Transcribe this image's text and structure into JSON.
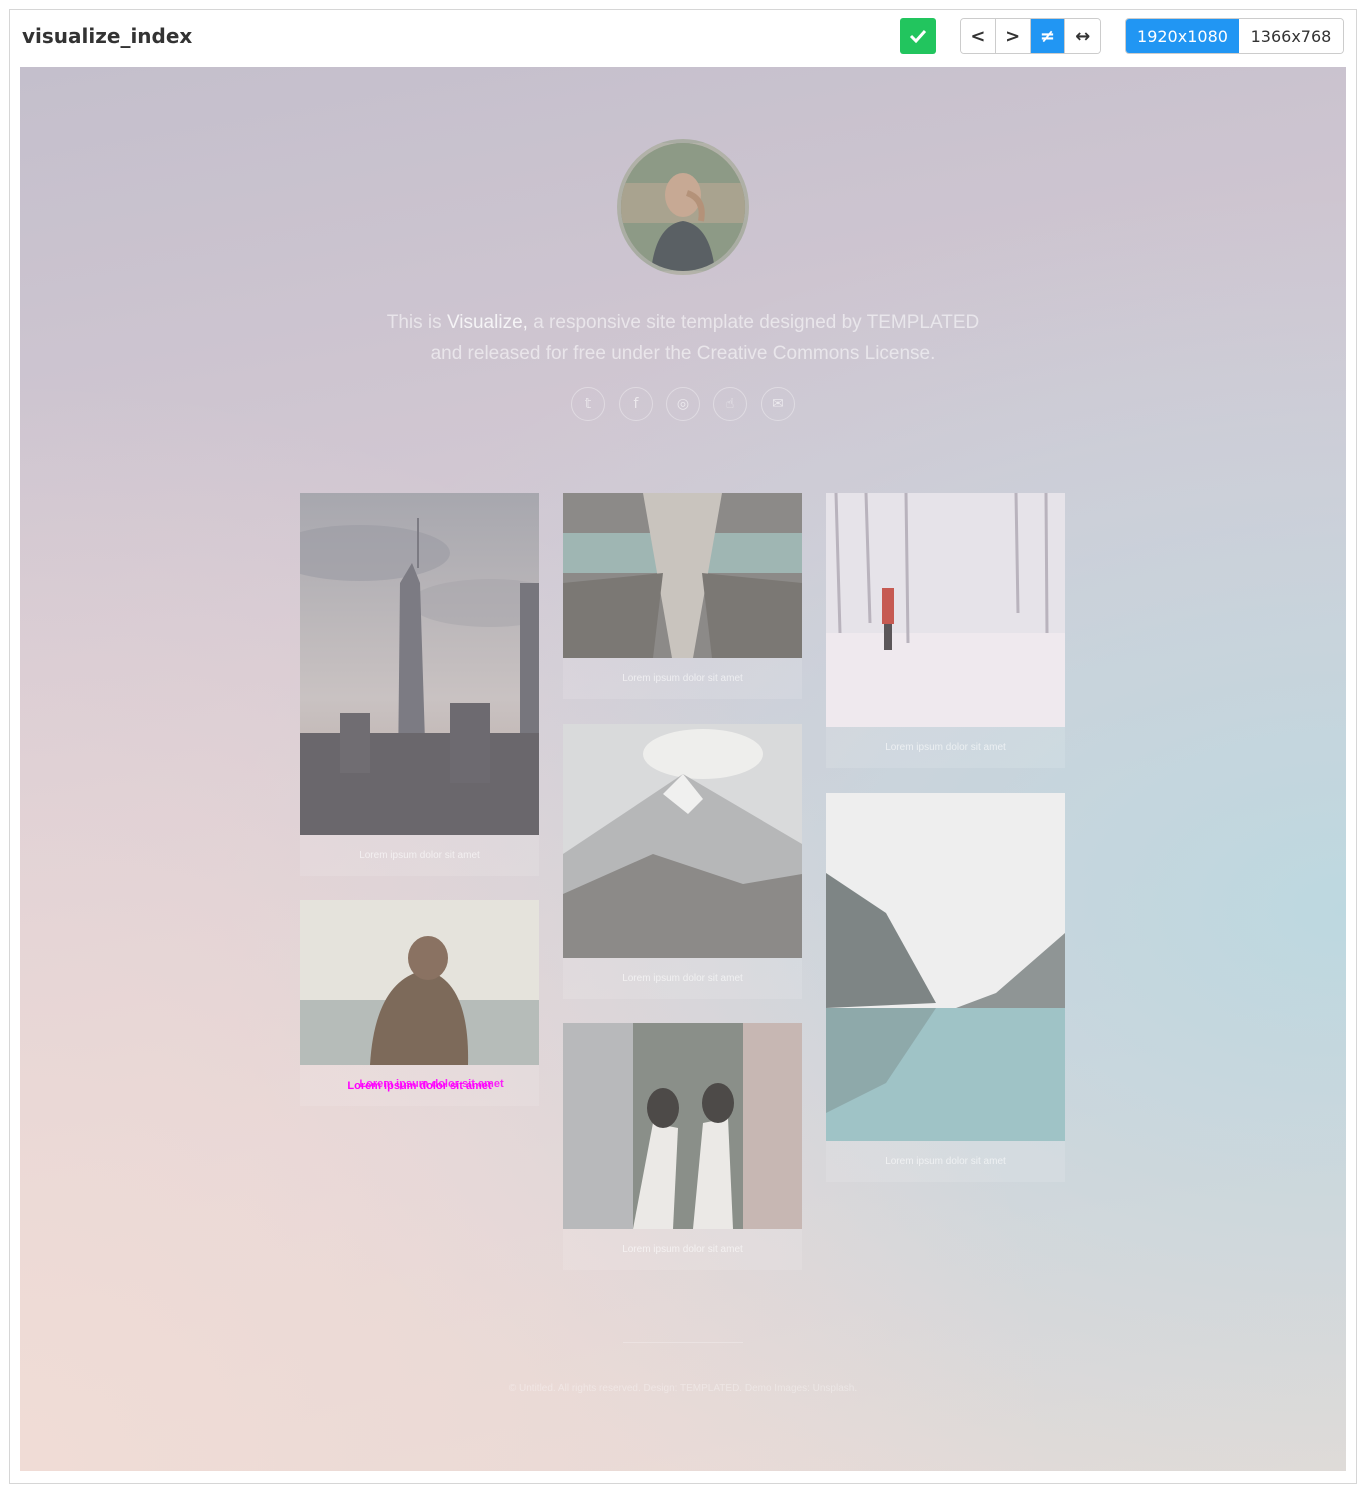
{
  "toolbar": {
    "title": "visualize_index",
    "confirm_icon": "check-icon",
    "prev_label": "<",
    "next_label": ">",
    "diff_label": "≠",
    "swap_label": "↔",
    "resolutions": [
      "1920x1080",
      "1366x768"
    ],
    "active_resolution": "1920x1080",
    "accent_color": "#2196f3",
    "confirm_color": "#22c55e"
  },
  "page": {
    "intro_prefix": "This is ",
    "intro_brand": "Visualize,",
    "intro_mid": " a responsive site template designed by ",
    "intro_author": "TEMPLATED",
    "intro_line2": "and released for free under the Creative Commons License.",
    "social_icons": [
      "twitter-icon",
      "facebook-icon",
      "instagram-icon",
      "dribbble-icon",
      "envelope-icon"
    ],
    "social_glyphs": [
      "𝕥",
      "f",
      "◎",
      "☝",
      "✉"
    ],
    "gallery": [
      {
        "caption": "Lorem ipsum dolor sit amet",
        "scene": "city-skyline"
      },
      {
        "caption": "Lorem ipsum dolor sit amet",
        "scene": "escalator"
      },
      {
        "caption": "Lorem ipsum dolor sit amet",
        "scene": "snow-forest"
      },
      {
        "caption": "Lorem ipsum dolor sit amet",
        "scene": "mountain-peak"
      },
      {
        "caption": "Lorem ipsum dolor sit amet",
        "scene": "woman-sea"
      },
      {
        "caption": "Lorem ipsum dolor sit amet",
        "scene": "lake-mountains"
      },
      {
        "caption": "Lorem ipsum dolor sit amet",
        "scene": "feet-over-city"
      }
    ],
    "footer": "© Untitled. All rights reserved. Design: TEMPLATED. Demo Images: Unsplash."
  }
}
